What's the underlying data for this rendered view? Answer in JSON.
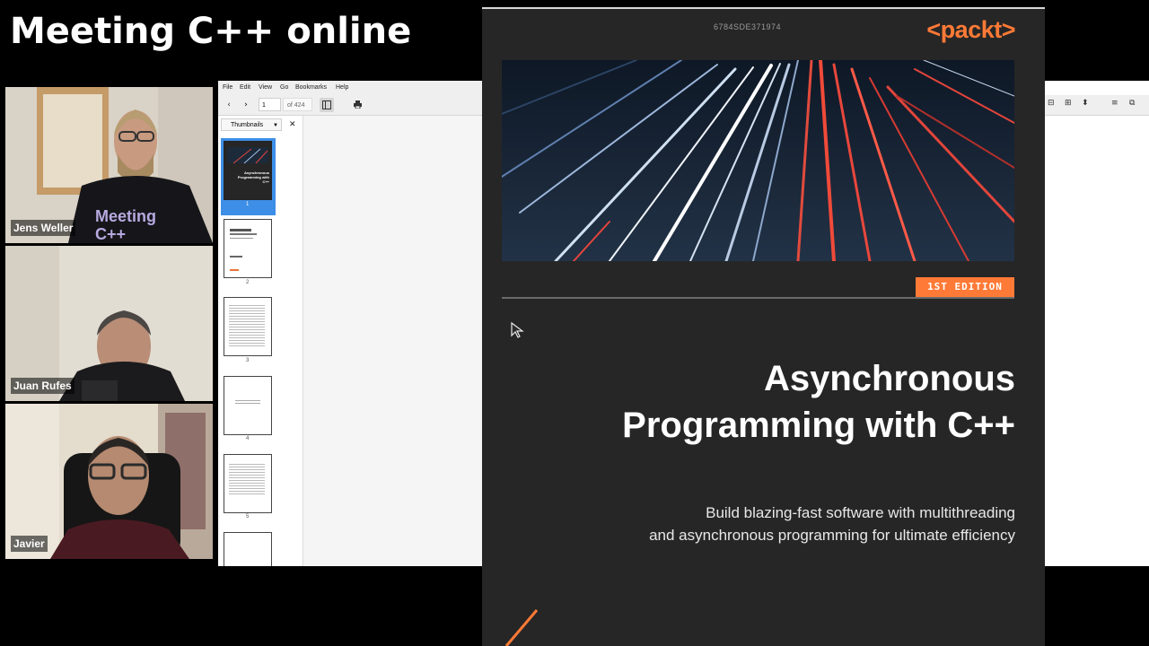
{
  "stream": {
    "title": "Meeting C++ online"
  },
  "participants": [
    {
      "name": "Jens Weller",
      "shirt_text": "Meeting C++"
    },
    {
      "name": "Juan Rufes"
    },
    {
      "name": "Javier"
    }
  ],
  "viewer": {
    "menu": [
      "File",
      "Edit",
      "View",
      "Go",
      "Bookmarks",
      "Help"
    ],
    "page_current": "1",
    "page_total": "of 424",
    "sidebar_mode": "Thumbnails",
    "thumbnails": [
      {
        "num": "1",
        "title": "Asynchronous Programming with C++",
        "selected": true
      },
      {
        "num": "2"
      },
      {
        "num": "3"
      },
      {
        "num": "4"
      },
      {
        "num": "5"
      }
    ]
  },
  "cover": {
    "isbn": "6784SDE371974",
    "brand": "<packt>",
    "edition": "1ST EDITION",
    "title_line1": "Asynchronous",
    "title_line2": "Programming with C++",
    "subtitle_line1": "Build blazing-fast software with multithreading",
    "subtitle_line2": "and asynchronous programming for ultimate efficiency",
    "accent_color": "#ff7a36"
  },
  "icons": [
    "back-arrow-icon",
    "forward-arrow-icon",
    "sidebar-toggle-icon",
    "print-icon",
    "close-icon",
    "zoom-out-icon",
    "zoom-in-icon",
    "fit-page-icon",
    "mouse-cursor-icon"
  ]
}
